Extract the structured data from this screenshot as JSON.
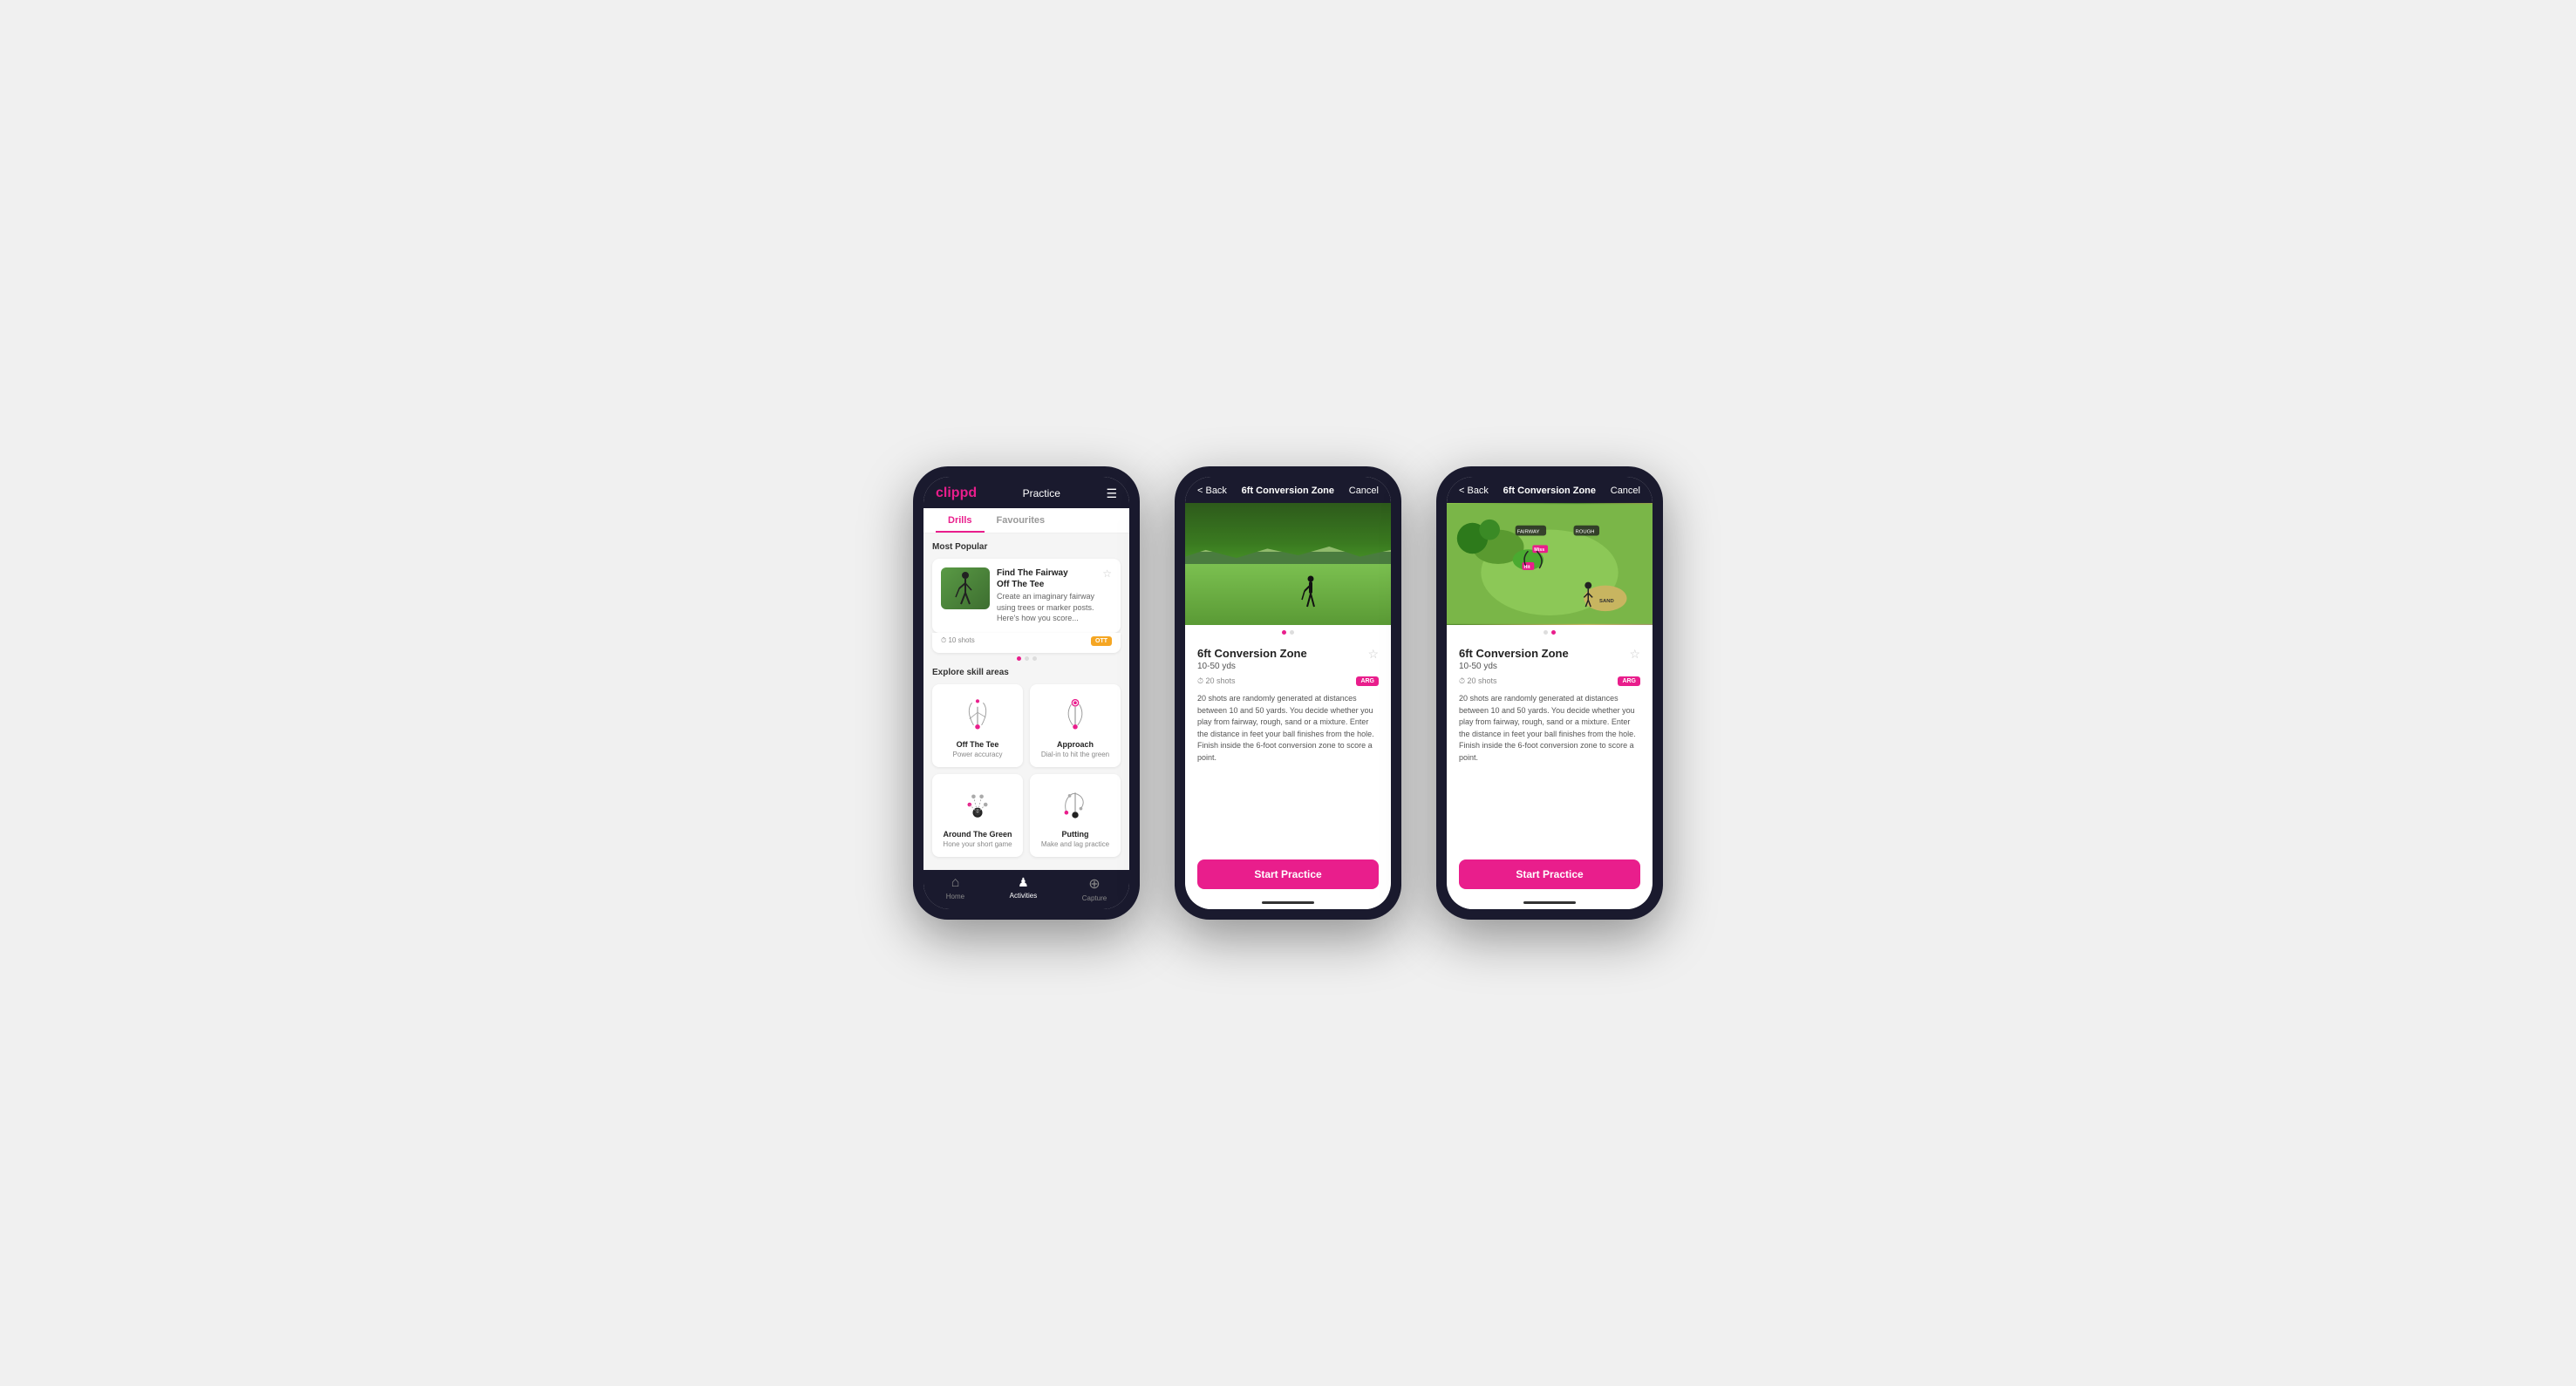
{
  "phones": [
    {
      "id": "phone1",
      "header": {
        "logo": "clippd",
        "title": "Practice",
        "menu_icon": "☰"
      },
      "tabs": [
        {
          "label": "Drills",
          "active": true
        },
        {
          "label": "Favourites",
          "active": false
        }
      ],
      "most_popular_label": "Most Popular",
      "featured_drill": {
        "title": "Find The Fairway",
        "subtitle": "Off The Tee",
        "description": "Create an imaginary fairway using trees or marker posts. Here's how you score...",
        "shots": "10 shots",
        "badge": "OTT"
      },
      "explore_label": "Explore skill areas",
      "skills": [
        {
          "name": "Off The Tee",
          "desc": "Power accuracy",
          "icon_type": "ott"
        },
        {
          "name": "Approach",
          "desc": "Dial-in to hit the green",
          "icon_type": "approach"
        },
        {
          "name": "Around The Green",
          "desc": "Hone your short game",
          "icon_type": "atg"
        },
        {
          "name": "Putting",
          "desc": "Make and lag practice",
          "icon_type": "putting"
        }
      ],
      "nav": [
        {
          "label": "Home",
          "icon": "⌂",
          "active": false
        },
        {
          "label": "Activities",
          "icon": "♟",
          "active": true
        },
        {
          "label": "Capture",
          "icon": "⊕",
          "active": false
        }
      ]
    },
    {
      "id": "phone2",
      "header": {
        "back": "< Back",
        "title": "6ft Conversion Zone",
        "cancel": "Cancel"
      },
      "image_type": "photo",
      "drill_title": "6ft Conversion Zone",
      "range": "10-50 yds",
      "shots": "20 shots",
      "badge": "ARG",
      "description": "20 shots are randomly generated at distances between 10 and 50 yards. You decide whether you play from fairway, rough, sand or a mixture. Enter the distance in feet your ball finishes from the hole. Finish inside the 6-foot conversion zone to score a point.",
      "start_btn": "Start Practice"
    },
    {
      "id": "phone3",
      "header": {
        "back": "< Back",
        "title": "6ft Conversion Zone",
        "cancel": "Cancel"
      },
      "image_type": "map",
      "drill_title": "6ft Conversion Zone",
      "range": "10-50 yds",
      "shots": "20 shots",
      "badge": "ARG",
      "description": "20 shots are randomly generated at distances between 10 and 50 yards. You decide whether you play from fairway, rough, sand or a mixture. Enter the distance in feet your ball finishes from the hole. Finish inside the 6-foot conversion zone to score a point.",
      "start_btn": "Start Practice"
    }
  ]
}
